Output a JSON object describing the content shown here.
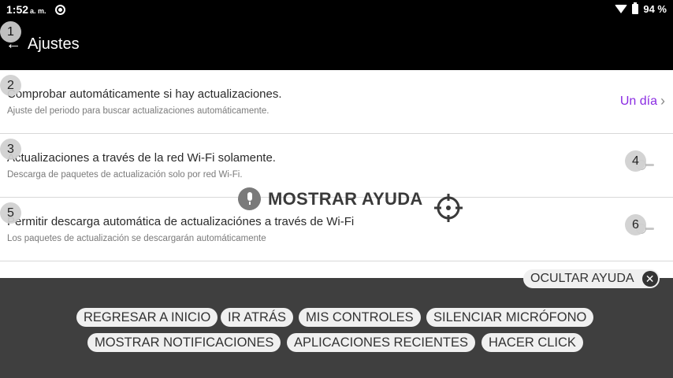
{
  "status_bar": {
    "time": "1:52",
    "ampm": "a. m.",
    "battery": "94 %"
  },
  "app_bar": {
    "back_icon": "back-arrow-icon",
    "title": "Ajustes"
  },
  "badges": [
    "1",
    "2",
    "3",
    "4",
    "5",
    "6"
  ],
  "settings": [
    {
      "title": "Comprobar automáticamente si hay actualizaciones.",
      "subtitle": "Ajuste del periodo para buscar actualizaciones automáticamente.",
      "value": "Un día"
    },
    {
      "title": "Actualizaciones a través de la red Wi-Fi solamente.",
      "subtitle": "Descarga de paquetes de actualización solo por red Wi-Fi."
    },
    {
      "title": "Permitir descarga automática de actualizaciónes a través de Wi-Fi",
      "subtitle": "Los paquetes de actualización se descargarán automáticamente"
    }
  ],
  "overlay": {
    "show_help": "MOSTRAR AYUDA",
    "hide_help": "OCULTAR AYUDA",
    "commands": [
      "REGRESAR A INICIO",
      "IR ATRÁS",
      "MIS CONTROLES",
      "SILENCIAR MICRÓFONO",
      "MOSTRAR NOTIFICACIONES",
      "APLICACIONES RECIENTES",
      "HACER CLICK"
    ]
  },
  "colors": {
    "accent": "#8a2be2",
    "panel": "#3f3f3f",
    "chip": "#f0f0f0"
  }
}
